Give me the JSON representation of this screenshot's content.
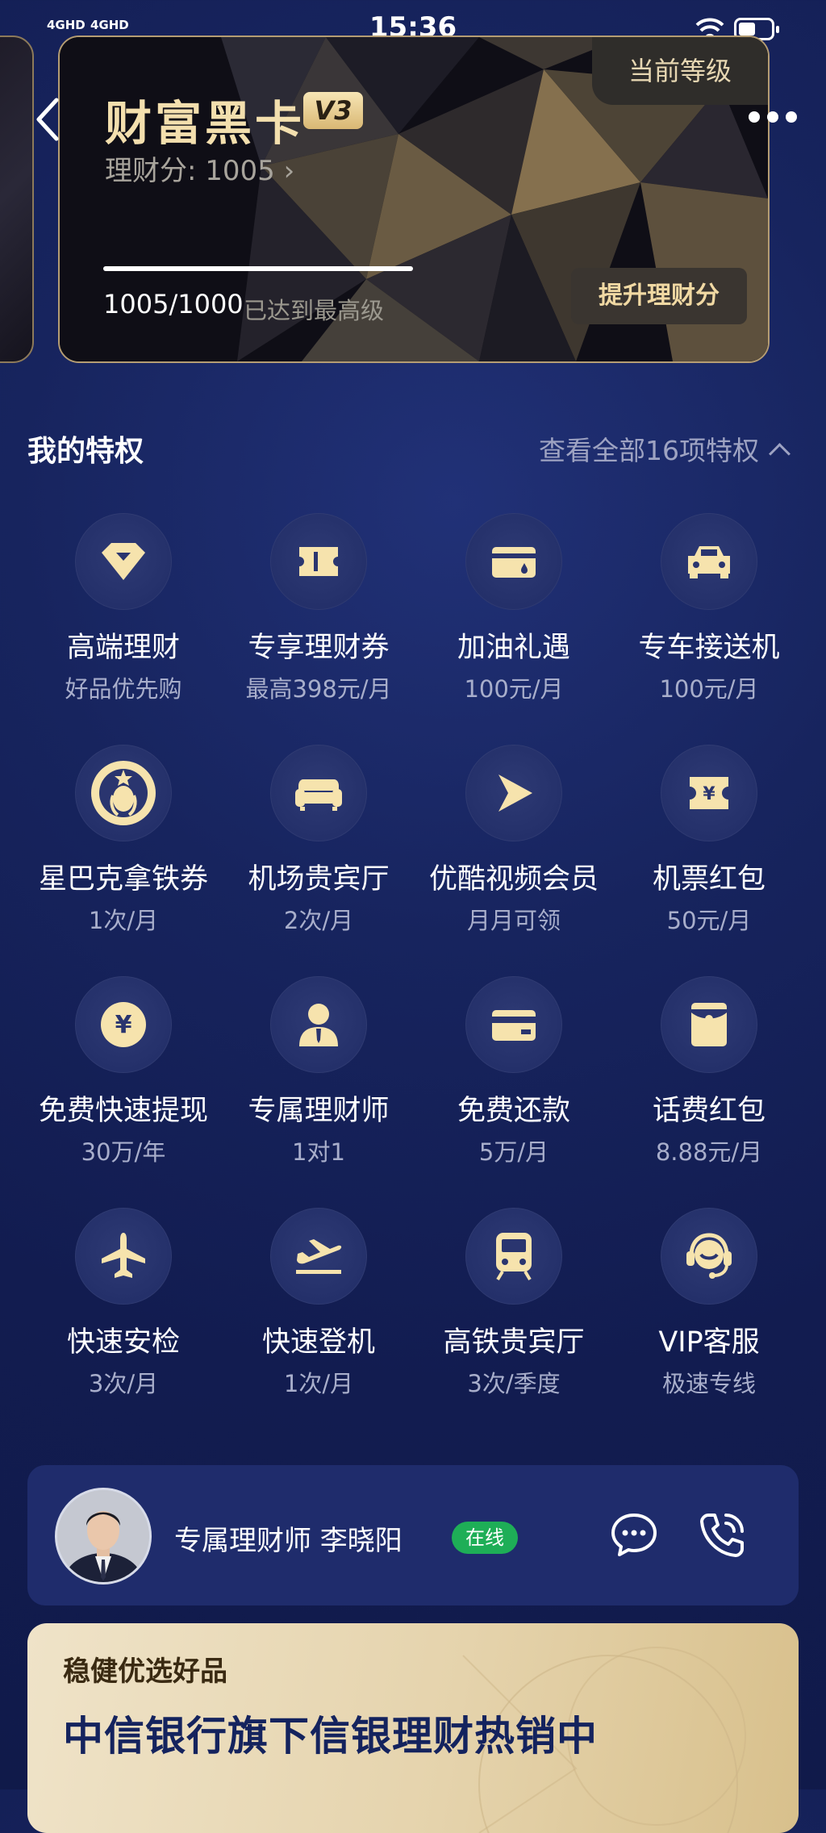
{
  "status_bar": {
    "signal1": "4GHD",
    "signal2": "4GHD",
    "time": "15:36"
  },
  "card": {
    "title": "财富黑卡",
    "level": "V3",
    "score_text": "理财分: 1005",
    "current_level_label": "当前等级",
    "progress_value": "1005/1000",
    "progress_fraction": 1.0,
    "progress_note": "已达到最高级",
    "upgrade_button": "提升理财分"
  },
  "privileges": {
    "title": "我的特权",
    "view_all": "查看全部16项特权",
    "items": [
      {
        "icon": "diamond-icon",
        "label": "高端理财",
        "sub": "好品优先购"
      },
      {
        "icon": "coupon-icon",
        "label": "专享理财券",
        "sub": "最高398元/月"
      },
      {
        "icon": "fuel-card-icon",
        "label": "加油礼遇",
        "sub": "100元/月"
      },
      {
        "icon": "car-icon",
        "label": "专车接送机",
        "sub": "100元/月"
      },
      {
        "icon": "starbucks-icon",
        "label": "星巴克拿铁券",
        "sub": "1次/月"
      },
      {
        "icon": "sofa-icon",
        "label": "机场贵宾厅",
        "sub": "2次/月"
      },
      {
        "icon": "play-icon",
        "label": "优酷视频会员",
        "sub": "月月可领"
      },
      {
        "icon": "ticket-icon",
        "label": "机票红包",
        "sub": "50元/月"
      },
      {
        "icon": "yuan-coin-icon",
        "label": "免费快速提现",
        "sub": "30万/年"
      },
      {
        "icon": "advisor-person-icon",
        "label": "专属理财师",
        "sub": "1对1"
      },
      {
        "icon": "card-icon",
        "label": "免费还款",
        "sub": "5万/月"
      },
      {
        "icon": "red-packet-icon",
        "label": "话费红包",
        "sub": "8.88元/月"
      },
      {
        "icon": "airplane-icon",
        "label": "快速安检",
        "sub": "3次/月"
      },
      {
        "icon": "departure-icon",
        "label": "快速登机",
        "sub": "1次/月"
      },
      {
        "icon": "train-icon",
        "label": "高铁贵宾厅",
        "sub": "3次/季度"
      },
      {
        "icon": "headset-icon",
        "label": "VIP客服",
        "sub": "极速专线"
      }
    ]
  },
  "advisor": {
    "name": "专属理财师 李晓阳",
    "status": "在线"
  },
  "promo": {
    "tag": "稳健优选好品",
    "title": "中信银行旗下信银理财热销中"
  }
}
